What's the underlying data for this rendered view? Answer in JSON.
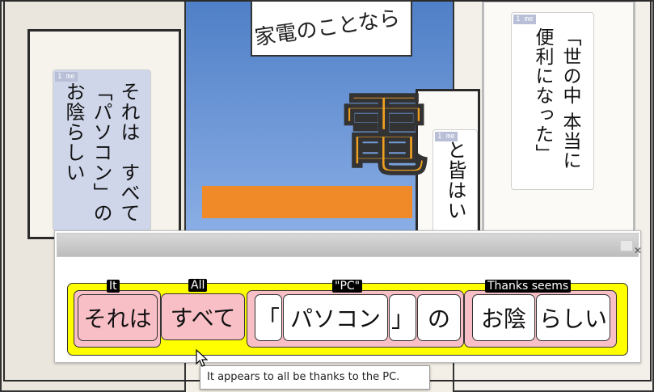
{
  "manga_bubbles": {
    "tag_text": "1",
    "tag_label": "me",
    "left_bubble": {
      "lines": [
        "それは　すべて",
        "「パソコン」の",
        "お陰らしい"
      ]
    },
    "middle_bubble": {
      "lines": [
        "と皆はい"
      ]
    },
    "right_bubble": {
      "lines": [
        "「世の中 本当に",
        "便利になった」"
      ]
    },
    "sign_text": "家電のことなら",
    "sign_big_char": "電"
  },
  "parser_window": {
    "groups": [
      {
        "gloss": "It",
        "words": [
          {
            "text": "それは",
            "style": "pink"
          }
        ]
      },
      {
        "gloss": "All",
        "words": [
          {
            "text": "すべて",
            "style": "pink"
          }
        ]
      },
      {
        "gloss": "\"PC\"",
        "words": [
          {
            "text": "「",
            "style": "white"
          },
          {
            "text": "パソコン",
            "style": "white"
          },
          {
            "text": "」",
            "style": "white"
          },
          {
            "text": "の",
            "style": "white"
          }
        ]
      },
      {
        "gloss": "Thanks seems",
        "words": [
          {
            "text": "お陰",
            "style": "white"
          },
          {
            "text": "らしい",
            "style": "white"
          }
        ]
      }
    ],
    "translation_tooltip": "It appears to all be thanks to the PC."
  },
  "colors": {
    "phrase_bar": "#ffff00",
    "group_fill": "#f9bfc7",
    "gloss_bg": "#000000"
  }
}
